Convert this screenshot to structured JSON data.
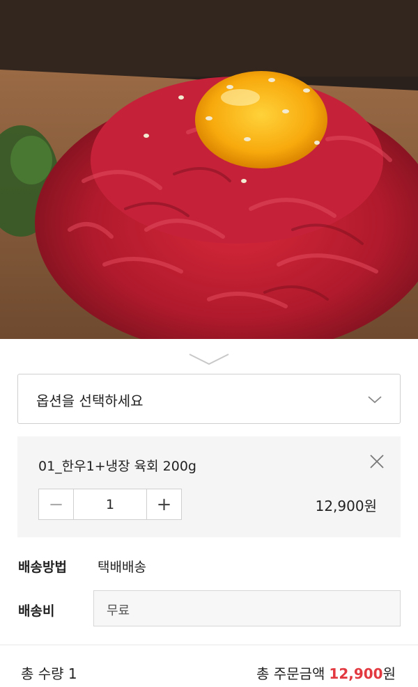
{
  "hero": {
    "image": "raw-beef-yukhoe-with-egg-yolk-photo"
  },
  "handle": {
    "icon": "chevron-down-icon"
  },
  "option_select": {
    "placeholder": "옵션을 선택하세요",
    "icon": "chevron-down-icon"
  },
  "selected_item": {
    "name": "01_한우1+냉장 육회 200g",
    "quantity": "1",
    "minus": "−",
    "plus": "+",
    "price": "12,900원"
  },
  "shipping": {
    "method_label": "배송방법",
    "method_value": "택배배송",
    "fee_label": "배송비",
    "fee_value": "무료"
  },
  "footer": {
    "total_qty": "총 수량 1",
    "total_label": "총 주문금액",
    "total_price": "12,900",
    "currency": "원",
    "accent_color": "#e2383f"
  }
}
